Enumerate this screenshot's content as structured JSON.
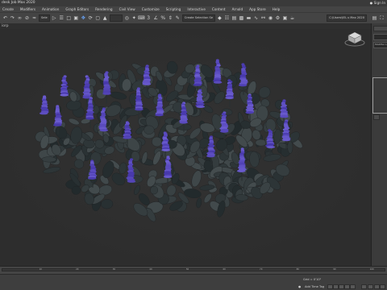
{
  "window": {
    "title": "desk Job Max 2020",
    "sign_in": "Sign In"
  },
  "menu": [
    "Create",
    "Modifiers",
    "Animation",
    "Graph Editors",
    "Rendering",
    "Civil View",
    "Customize",
    "Scripting",
    "Interactive",
    "Content",
    "Arnold",
    "App Store",
    "Help"
  ],
  "toolbar": {
    "filter_dropdown": "Sele",
    "selection_set_dropdown": "Create Selection Se",
    "workspace_dropdown": "C:\\Users\\65..s Max 2020"
  },
  "viewport": {
    "label": "iorp",
    "background": "#2d2d2d"
  },
  "command_panel": {
    "modifier_list": "Modifier Li"
  },
  "timeline": {
    "ticks": [
      "10",
      "20",
      "30",
      "40",
      "50",
      "60",
      "70",
      "80",
      "90",
      "100"
    ]
  },
  "status": {
    "grid": "Grid = 0'10\"",
    "add_time_tag": "Add Time Tag"
  },
  "colors": {
    "flower": "#5b4bb8",
    "leaf": "#3a4042"
  }
}
